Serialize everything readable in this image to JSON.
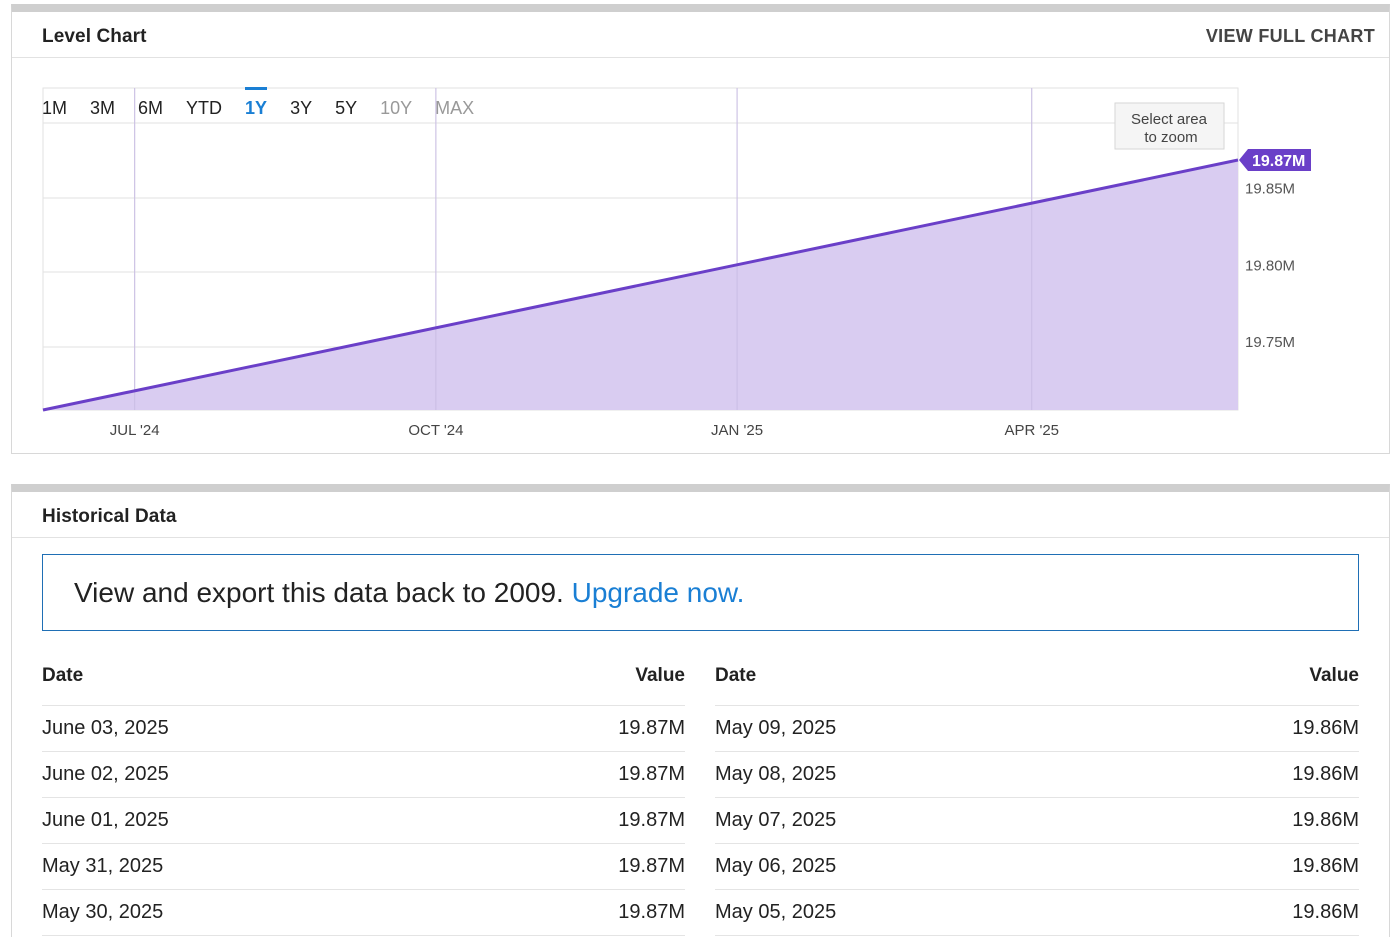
{
  "level_chart": {
    "title": "Level Chart",
    "view_full_label": "VIEW FULL CHART",
    "ranges": [
      {
        "label": "1M",
        "state": "normal"
      },
      {
        "label": "3M",
        "state": "normal"
      },
      {
        "label": "6M",
        "state": "normal"
      },
      {
        "label": "YTD",
        "state": "normal"
      },
      {
        "label": "1Y",
        "state": "active"
      },
      {
        "label": "3Y",
        "state": "normal"
      },
      {
        "label": "5Y",
        "state": "normal"
      },
      {
        "label": "10Y",
        "state": "disabled"
      },
      {
        "label": "MAX",
        "state": "disabled"
      }
    ],
    "zoom_hint_line1": "Select area",
    "zoom_hint_line2": "to zoom",
    "current_value_label": "19.87M"
  },
  "chart_data": {
    "type": "area",
    "x": [
      "2024-06-03",
      "2025-06-03"
    ],
    "y": [
      19.705,
      19.868
    ],
    "x_tick_labels": [
      "JUL '24",
      "OCT '24",
      "JAN '25",
      "APR '25"
    ],
    "x_tick_dates": [
      "2024-07-01",
      "2024-10-01",
      "2025-01-01",
      "2025-04-01"
    ],
    "y_tick_labels": [
      "19.75M",
      "19.80M",
      "19.85M"
    ],
    "y_tick_values": [
      19.75,
      19.8,
      19.85
    ],
    "ylim": [
      19.705,
      19.868
    ],
    "line_color": "#6a3fc8",
    "fill_color": "#d9ccf1",
    "grid": true
  },
  "historical": {
    "title": "Historical Data",
    "notice_text": "View and export this data back to 2009. ",
    "notice_link": "Upgrade now.",
    "col_date": "Date",
    "col_value": "Value",
    "left_rows": [
      {
        "date": "June 03, 2025",
        "value": "19.87M"
      },
      {
        "date": "June 02, 2025",
        "value": "19.87M"
      },
      {
        "date": "June 01, 2025",
        "value": "19.87M"
      },
      {
        "date": "May 31, 2025",
        "value": "19.87M"
      },
      {
        "date": "May 30, 2025",
        "value": "19.87M"
      }
    ],
    "right_rows": [
      {
        "date": "May 09, 2025",
        "value": "19.86M"
      },
      {
        "date": "May 08, 2025",
        "value": "19.86M"
      },
      {
        "date": "May 07, 2025",
        "value": "19.86M"
      },
      {
        "date": "May 06, 2025",
        "value": "19.86M"
      },
      {
        "date": "May 05, 2025",
        "value": "19.86M"
      }
    ]
  }
}
